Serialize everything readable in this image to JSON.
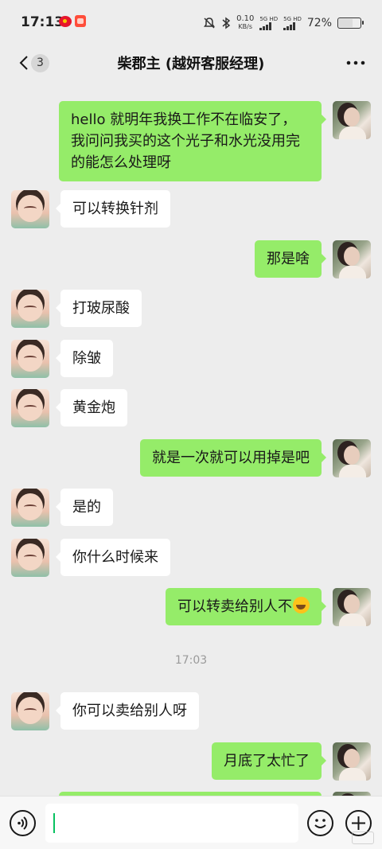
{
  "status_bar": {
    "time": "17:13",
    "net_speed_value": "0.10",
    "net_speed_unit": "KB/s",
    "sim1_label": "5G HD",
    "sim2_label": "5G HD",
    "battery_percent": "72%",
    "battery_level": 0.72,
    "icons": [
      "weibo-icon",
      "app-notification-icon",
      "mute-icon",
      "bluetooth-icon",
      "signal-icon",
      "battery-icon"
    ]
  },
  "header": {
    "back_icon": "chevron-left-icon",
    "unread_count": "3",
    "title": "柴郡主 (越妍客服经理)",
    "more_icon": "more-dots-icon"
  },
  "messages": [
    {
      "side": "right",
      "text": "hello 就明年我换工作不在临安了，我问问我买的这个光子和水光没用完的能怎么处理呀"
    },
    {
      "side": "left",
      "text": "可以转换针剂"
    },
    {
      "side": "right",
      "text": "那是啥"
    },
    {
      "side": "left",
      "text": "打玻尿酸"
    },
    {
      "side": "left",
      "text": "除皱"
    },
    {
      "side": "left",
      "text": "黄金炮"
    },
    {
      "side": "right",
      "text": "就是一次就可以用掉是吧"
    },
    {
      "side": "left",
      "text": "是的"
    },
    {
      "side": "left",
      "text": "你什么时候来"
    },
    {
      "side": "right",
      "text": "可以转卖给别人不",
      "emoji": "laughing-crying-emoji"
    },
    {
      "side": "left",
      "text": "你可以卖给别人呀"
    },
    {
      "side": "right",
      "text": "月底了太忙了"
    }
  ],
  "timestamp": "17:03",
  "input_bar": {
    "voice_icon": "voice-icon",
    "emoji_icon": "emoji-face-icon",
    "plus_icon": "plus-icon",
    "input_value": ""
  },
  "colors": {
    "background": "#ededed",
    "my_bubble": "#95ec69",
    "their_bubble": "#ffffff",
    "cursor": "#07c160"
  }
}
